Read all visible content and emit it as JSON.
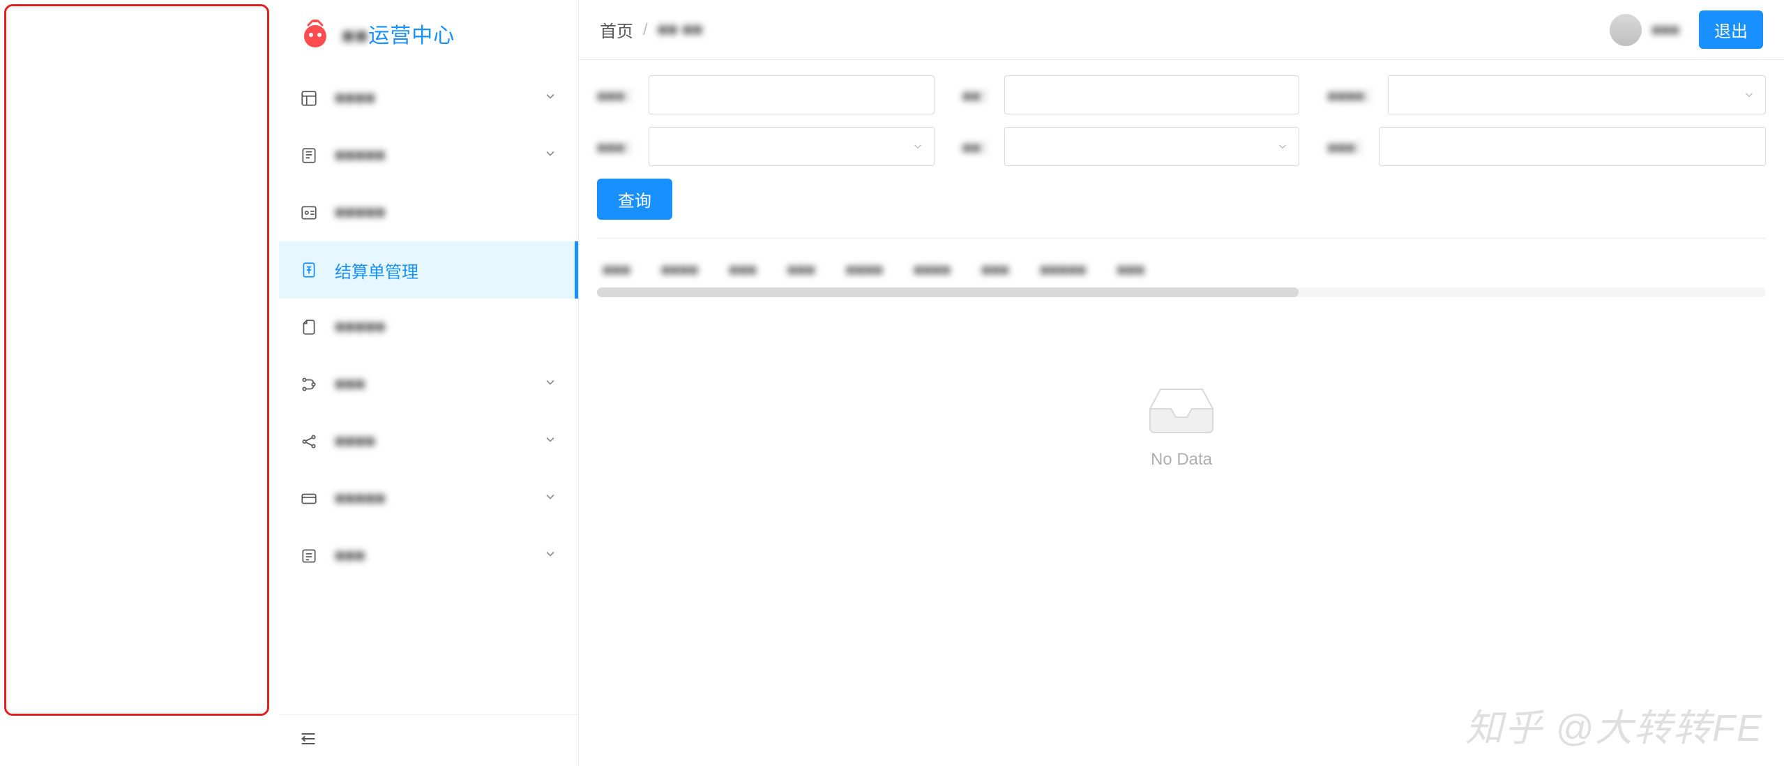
{
  "app": {
    "title_suffix": "运营中心",
    "title_prefix_obscured": "■■"
  },
  "sidebar": {
    "items": [
      {
        "label_obscured": "■■■■",
        "expandable": true,
        "active": false
      },
      {
        "label_obscured": "■■■■■",
        "expandable": true,
        "active": false
      },
      {
        "label_obscured": "■■■■■",
        "expandable": false,
        "active": false
      },
      {
        "label": "结算单管理",
        "expandable": false,
        "active": true
      },
      {
        "label_obscured": "■■■■■",
        "expandable": false,
        "active": false
      },
      {
        "label_obscured": "■■■",
        "expandable": true,
        "active": false
      },
      {
        "label_obscured": "■■■■",
        "expandable": true,
        "active": false
      },
      {
        "label_obscured": "■■■■■",
        "expandable": true,
        "active": false
      },
      {
        "label_obscured": "■■■",
        "expandable": true,
        "active": false
      }
    ]
  },
  "breadcrumb": {
    "home": "首页",
    "current_obscured": "■■ ■■"
  },
  "user": {
    "name_obscured": "■■■",
    "logout": "退出"
  },
  "filters": {
    "row1": [
      {
        "label_obscured": "■■■：",
        "type": "input"
      },
      {
        "label_obscured": "■■：",
        "type": "input"
      },
      {
        "label_obscured": "■■■■：",
        "type": "select"
      }
    ],
    "row2": [
      {
        "label_obscured": "■■■：",
        "type": "select"
      },
      {
        "label_obscured": "■■：",
        "type": "select"
      },
      {
        "label_obscured": "■■■：",
        "type": "input"
      }
    ],
    "search_button": "查询"
  },
  "table": {
    "headers_obscured": [
      "■■■",
      "■■■■",
      "■■■",
      "■■■",
      "■■■■",
      "■■■■",
      "■■■",
      "■■■■■",
      "■■■"
    ],
    "empty_text": "No Data"
  },
  "watermark": "知乎 @大转转FE"
}
